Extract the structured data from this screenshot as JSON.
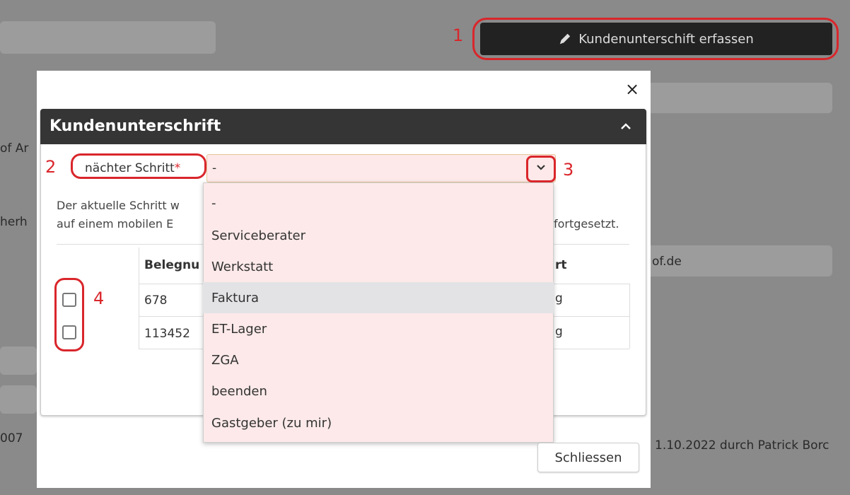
{
  "background": {
    "left_fragments": [
      "of Ar",
      "herh",
      "007"
    ],
    "right_fragments": [
      "of.de",
      "1.10.2022 durch Patrick Borc"
    ]
  },
  "top_button": {
    "label": "Kundenunterschift erfassen",
    "icon": "pencil-icon"
  },
  "annotations": [
    "1",
    "2",
    "3",
    "4"
  ],
  "modal": {
    "close_symbol": "×",
    "panel_title": "Kundenunterschrift",
    "field": {
      "label": "nächter Schritt",
      "required_mark": "*",
      "value": "-"
    },
    "description": {
      "line1_start": "Der aktuelle Schritt w",
      "line2_start": "auf einem mobilen E",
      "line2_end": "fortgesetzt."
    },
    "table": {
      "headers": {
        "belegnummer": "Belegnu",
        "last": "rt"
      },
      "rows": [
        {
          "belegnummer": "678",
          "last": "g"
        },
        {
          "belegnummer": "113452",
          "last": "g"
        }
      ]
    },
    "close_button": "Schliessen"
  },
  "dropdown": {
    "options": [
      "-",
      "Serviceberater",
      "Werkstatt",
      "Faktura",
      "ET-Lager",
      "ZGA",
      "beenden",
      "Gastgeber (zu mir)"
    ],
    "highlighted": "Faktura"
  },
  "colors": {
    "accent_red": "#d9262b",
    "header_dark": "#353535",
    "dropdown_bg": "#fde9e9"
  }
}
